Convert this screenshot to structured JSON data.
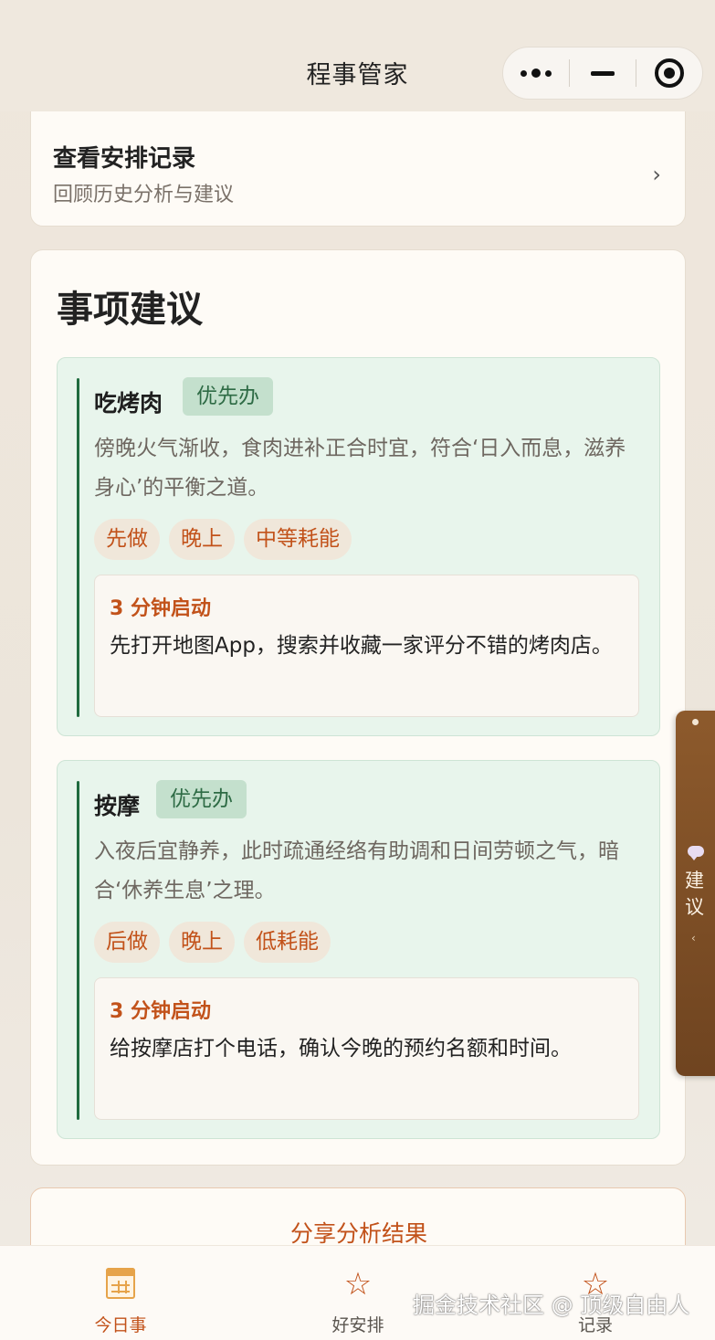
{
  "navbar": {
    "title": "程事管家",
    "menu_icon": "more-dots-icon",
    "minimize_icon": "minimize-icon",
    "close_icon": "target-close-icon"
  },
  "history": {
    "title": "查看安排记录",
    "subtitle": "回顾历史分析与建议",
    "chevron": "›"
  },
  "suggestions": {
    "title": "事项建议",
    "quick_start_label": "3 分钟启动",
    "items": [
      {
        "name": "吃烤肉",
        "priority": "优先办",
        "description": "傍晚火气渐收，食肉进补正合时宜，符合‘日入而息，滋养身心’的平衡之道。",
        "tags": [
          "先做",
          "晚上",
          "中等耗能"
        ],
        "quick_start": "先打开地图App，搜索并收藏一家评分不错的烤肉店。"
      },
      {
        "name": "按摩",
        "priority": "优先办",
        "description": "入夜后宜静养，此时疏通经络有助调和日间劳顿之气，暗合‘休养生息’之理。",
        "tags": [
          "后做",
          "晚上",
          "低耗能"
        ],
        "quick_start": "给按摩店打个电话，确认今晚的预约名额和时间。"
      }
    ]
  },
  "share": {
    "label": "分享分析结果"
  },
  "side_tab": {
    "label": "建议",
    "chevron": "‹"
  },
  "tabbar": {
    "tabs": [
      {
        "label": "今日事",
        "icon": "calendar-icon",
        "active": true
      },
      {
        "label": "好安排",
        "icon": "star-icon",
        "active": false
      },
      {
        "label": "记录",
        "icon": "star-icon",
        "active": false
      }
    ]
  },
  "watermark": "掘金技术社区 @ 顶级自由人",
  "colors": {
    "accent": "#c2521a",
    "priority_bg": "#c4e0cd",
    "item_bg": "#e8f5ec",
    "side_tab": "#7b4a22"
  }
}
